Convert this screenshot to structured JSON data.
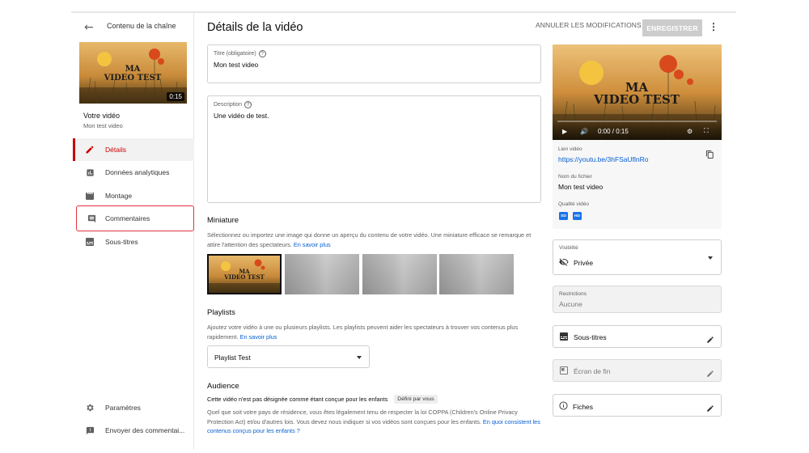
{
  "sidebar": {
    "header_title": "Contenu de la chaîne",
    "thumb_title": "MA VIDEO TEST",
    "thumb_duration": "0:15",
    "video_label": "Votre vidéo",
    "video_name": "Mon test video",
    "nav": [
      {
        "label": "Détails",
        "icon": "pencil-icon",
        "active": true
      },
      {
        "label": "Données analytiques",
        "icon": "analytics-icon"
      },
      {
        "label": "Montage",
        "icon": "clapper-icon"
      },
      {
        "label": "Commentaires",
        "icon": "comment-icon",
        "highlighted": true
      },
      {
        "label": "Sous-titres",
        "icon": "subtitles-icon"
      }
    ],
    "bottom": [
      {
        "label": "Paramètres",
        "icon": "gear-icon"
      },
      {
        "label": "Envoyer des commentai...",
        "icon": "feedback-icon"
      }
    ]
  },
  "header": {
    "title": "Détails de la vidéo",
    "cancel_label": "ANNULER LES MODIFICATIONS",
    "save_label": "ENREGISTRER"
  },
  "form": {
    "title_label": "Titre (obligatoire)",
    "title_value": "Mon test video",
    "desc_label": "Description",
    "desc_value": "Une vidéo de test.",
    "miniature_heading": "Miniature",
    "miniature_text": "Sélectionnez ou importez une image qui donne un aperçu du contenu de votre vidéo. Une miniature efficace se remarque et attire l'attention des spectateurs.",
    "miniature_link": "En savoir plus",
    "playlists_heading": "Playlists",
    "playlists_text": "Ajoutez votre vidéo à une ou plusieurs playlists. Les playlists peuvent aider les spectateurs à trouver vos contenus plus rapidement.",
    "playlists_link": "En savoir plus",
    "playlist_value": "Playlist Test",
    "audience_heading": "Audience",
    "audience_status": "Cette vidéo n'est pas désignée comme étant conçue pour les enfants",
    "audience_chip": "Défini par vous",
    "audience_text": "Quel que soit votre pays de résidence, vous êtes légalement tenu de respecter la loi COPPA (Children's Online Privacy Protection Act) et/ou d'autres lois. Vous devez nous indiquer si vos vidéos sont conçues pour les enfants.",
    "audience_link": "En quoi consistent les contenus conçus pour les enfants ?"
  },
  "right": {
    "player_title": "MA VIDEO TEST",
    "player_time": "0:00 / 0:15",
    "link_label": "Lien vidéo",
    "link_value": "https://youtu.be/3hFSaUflnRo",
    "file_label": "Nom du fichier",
    "file_value": "Mon test video",
    "quality_label": "Qualité vidéo",
    "quality_badges": [
      "SD",
      "HD"
    ],
    "visibility_label": "Visibilité",
    "visibility_value": "Privée",
    "restrictions_label": "Restrictions",
    "restrictions_value": "Aucune",
    "subtitles_label": "Sous-titres",
    "endscreen_label": "Écran de fin",
    "cards_label": "Fiches"
  },
  "colors": {
    "accent": "#cc0000",
    "link": "#065fd4",
    "highlight_box": "#e0333e"
  }
}
